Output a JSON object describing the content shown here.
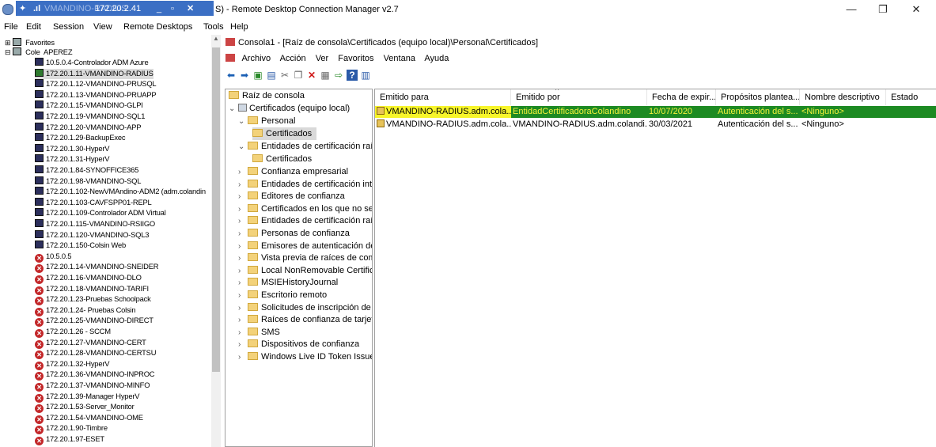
{
  "window": {
    "title": "Remote Desktop Connection Manager v2.7",
    "title_prefix_fragment": "S) - ",
    "rd_bar_ip": "172.20.2.41",
    "rd_bar_ghost_text": "VMANDINO-RADIUS",
    "minimize": "—",
    "maximize": "❐",
    "close": "✕"
  },
  "menu": [
    "File",
    "Edit",
    "Session",
    "View",
    "Remote Desktops",
    "Tools",
    "Help"
  ],
  "tree": {
    "favorites": "Favorites",
    "root_group": "Cole",
    "overlay_user": "APEREZ",
    "items": [
      {
        "label": "10.5.0.4-Controlador ADM Azure",
        "status": "ok"
      },
      {
        "label": "172.20.1.11-VMANDINO-RADIUS",
        "status": "connected"
      },
      {
        "label": "172.20.1.12-VMANDINO-PRUSQL",
        "status": "ok"
      },
      {
        "label": "172.20.1.13-VMANDINO-PRUAPP",
        "status": "ok"
      },
      {
        "label": "172.20.1.15-VMANDINO-GLPI",
        "status": "ok"
      },
      {
        "label": "172.20.1.19-VMANDINO-SQL1",
        "status": "ok"
      },
      {
        "label": "172.20.1.20-VMANDINO-APP",
        "status": "ok"
      },
      {
        "label": "172.20.1.29-BackupExec",
        "status": "ok"
      },
      {
        "label": "172.20.1.30-HyperV",
        "status": "ok"
      },
      {
        "label": "172.20.1.31-HyperV",
        "status": "ok"
      },
      {
        "label": "172.20.1.84-SYNOFFICE365",
        "status": "ok"
      },
      {
        "label": "172.20.1.98-VMANDINO-SQL",
        "status": "ok"
      },
      {
        "label": "172.20.1.102-NewVMAndino-ADM2 (adm.colandin",
        "status": "ok"
      },
      {
        "label": "172.20.1.103-CAVFSPP01-REPL",
        "status": "ok"
      },
      {
        "label": "172.20.1.109-Controlador ADM Virtual",
        "status": "ok"
      },
      {
        "label": "172.20.1.115-VMANDINO-RSIIGO",
        "status": "ok"
      },
      {
        "label": "172.20.1.120-VMANDINO-SQL3",
        "status": "ok"
      },
      {
        "label": "172.20.1.150-Colsin Web",
        "status": "ok"
      },
      {
        "label": "10.5.0.5",
        "status": "error"
      },
      {
        "label": "172.20.1.14-VMANDINO-SNEIDER",
        "status": "error"
      },
      {
        "label": "172.20.1.16-VMANDINO-DLO",
        "status": "error"
      },
      {
        "label": "172.20.1.18-VMANDINO-TARIFI",
        "status": "error"
      },
      {
        "label": "172.20.1.23-Pruebas Schoolpack",
        "status": "error"
      },
      {
        "label": "172.20.1.24- Pruebas Colsin",
        "status": "error"
      },
      {
        "label": "172.20.1.25-VMANDINO-DIRECT",
        "status": "error"
      },
      {
        "label": "172.20.1.26 - SCCM",
        "status": "error"
      },
      {
        "label": "172.20.1.27-VMANDINO-CERT",
        "status": "error"
      },
      {
        "label": "172.20.1.28-VMANDINO-CERTSU",
        "status": "error"
      },
      {
        "label": "172.20.1.32-HyperV",
        "status": "error"
      },
      {
        "label": "172.20.1.36-VMANDINO-INPROC",
        "status": "error"
      },
      {
        "label": "172.20.1.37-VMANDINO-MINFO",
        "status": "error"
      },
      {
        "label": "172.20.1.39-Manager HyperV",
        "status": "error"
      },
      {
        "label": "172.20.1.53-Server_Monitor",
        "status": "error"
      },
      {
        "label": "172.20.1.54-VMANDINO-OME",
        "status": "error"
      },
      {
        "label": "172.20.1.90-Timbre",
        "status": "error"
      },
      {
        "label": "172.20.1.97-ESET",
        "status": "error"
      }
    ]
  },
  "mmc": {
    "title": "Consola1 - [Raíz de consola\\Certificados (equipo local)\\Personal\\Certificados]",
    "menu": [
      "Archivo",
      "Acción",
      "Ver",
      "Favoritos",
      "Ventana",
      "Ayuda"
    ],
    "scope": {
      "root": "Raíz de consola",
      "certs_local": "Certificados (equipo local)",
      "personal": "Personal",
      "personal_certs": "Certificados",
      "ca_root": "Entidades de certificación raí",
      "ca_root_certs": "Certificados",
      "others": [
        "Confianza empresarial",
        "Entidades de certificación int",
        "Editores de confianza",
        "Certificados en los que no se",
        "Entidades de certificación raí",
        "Personas de confianza",
        "Emisores de autenticación de",
        "Vista previa de raíces de com",
        "Local NonRemovable Certific",
        "MSIEHistoryJournal",
        "Escritorio remoto",
        "Solicitudes de inscripción de",
        "Raíces de confianza de tarjeta",
        "SMS",
        "Dispositivos de confianza",
        "Windows Live ID Token Issue"
      ]
    },
    "columns": [
      "Emitido para",
      "Emitido por",
      "Fecha de expir...",
      "Propósitos plantea...",
      "Nombre descriptivo",
      "Estado"
    ],
    "rows": [
      [
        "VMANDINO-RADIUS.adm.cola...",
        "EntidadCertificadoraColandino",
        "10/07/2020",
        "Autenticación del s...",
        "<Ninguno>",
        ""
      ],
      [
        "VMANDINO-RADIUS.adm.cola...",
        "VMANDINO-RADIUS.adm.colandi...",
        "30/03/2021",
        "Autenticación del s...",
        "<Ninguno>",
        ""
      ]
    ]
  }
}
